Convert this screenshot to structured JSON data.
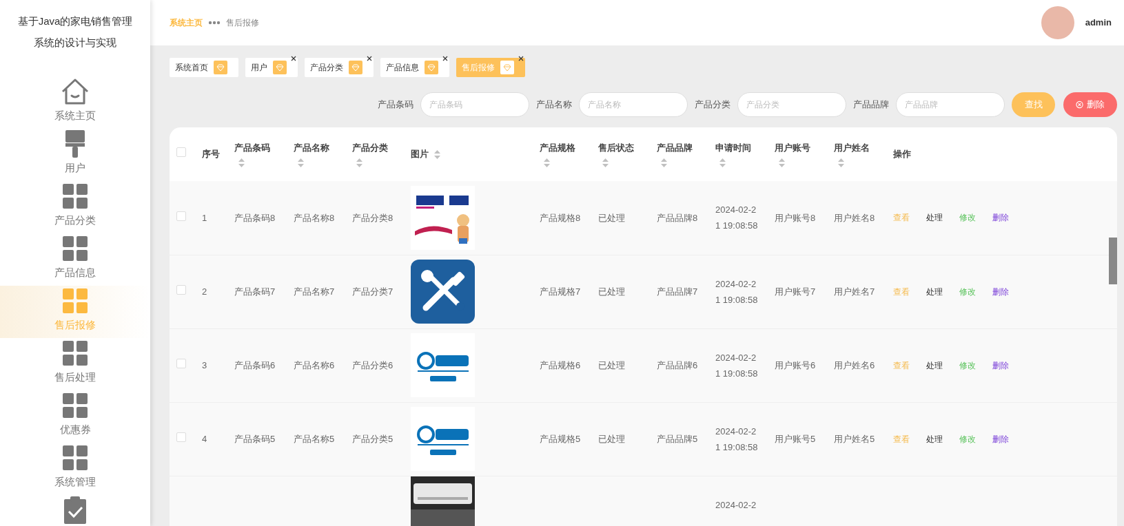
{
  "sidebar": {
    "title": "基于Java的家电销售管理系统的设计与实现",
    "items": [
      {
        "kind": "house",
        "label": "系统主页",
        "selected": false
      },
      {
        "kind": "brush",
        "label": "用户",
        "selected": false
      },
      {
        "kind": "grid",
        "label": "产品分类",
        "selected": false
      },
      {
        "kind": "grid",
        "label": "产品信息",
        "selected": false
      },
      {
        "kind": "grid",
        "label": "售后报修",
        "selected": true
      },
      {
        "kind": "grid",
        "label": "售后处理",
        "selected": false
      },
      {
        "kind": "grid",
        "label": "优惠券",
        "selected": false
      },
      {
        "kind": "grid",
        "label": "系统管理",
        "selected": false
      },
      {
        "kind": "clipboard",
        "selected": false
      }
    ]
  },
  "breadcrumb": [
    {
      "label": "系统主页",
      "current": false
    },
    {
      "label": "售后报修",
      "current": true
    }
  ],
  "user": {
    "name": "admin"
  },
  "tabs": [
    {
      "label": "系统首页",
      "closable": false,
      "selected": false
    },
    {
      "label": "用户",
      "closable": true,
      "selected": false
    },
    {
      "label": "产品分类",
      "closable": true,
      "selected": false
    },
    {
      "label": "产品信息",
      "closable": true,
      "selected": false
    },
    {
      "label": "售后报修",
      "closable": true,
      "selected": true
    }
  ],
  "search": {
    "fields": [
      {
        "label": "产品条码",
        "placeholder": "产品条码"
      },
      {
        "label": "产品名称",
        "placeholder": "产品名称"
      },
      {
        "label": "产品分类",
        "placeholder": "产品分类"
      },
      {
        "label": "产品品牌",
        "placeholder": "产品品牌"
      }
    ],
    "buttons": [
      {
        "kind": "search",
        "label": "查找"
      },
      {
        "kind": "delete",
        "label": "删除"
      }
    ]
  },
  "table": {
    "all_checked": false,
    "columns": [
      {
        "label": "序号",
        "sortable": false
      },
      {
        "label": "产品条码",
        "sortable": true
      },
      {
        "label": "产品名称",
        "sortable": true
      },
      {
        "label": "产品分类",
        "sortable": true
      },
      {
        "label": "图片",
        "sortable": true,
        "kind": "inline"
      },
      {
        "label": "产品规格",
        "sortable": true
      },
      {
        "label": "售后状态",
        "sortable": true
      },
      {
        "label": "产品品牌",
        "sortable": true
      },
      {
        "label": "申请时间",
        "sortable": true
      },
      {
        "label": "用户账号",
        "sortable": true
      },
      {
        "label": "用户姓名",
        "sortable": true
      },
      {
        "label": "操作",
        "sortable": false
      }
    ],
    "rows": [
      {
        "checked": false,
        "cells": [
          "1",
          "产品条码8",
          "产品名称8",
          "产品分类8",
          null,
          "产品规格8",
          "已处理",
          "产品品牌8",
          "2024-02-21 19:08:58",
          "用户账号8",
          "用户姓名8"
        ],
        "actions": [
          {
            "kind": "view",
            "label": "查看"
          },
          {
            "kind": "process",
            "label": "处理"
          },
          {
            "kind": "edit",
            "label": "修改"
          },
          {
            "kind": "delete",
            "label": "删除"
          }
        ]
      },
      {
        "checked": false,
        "cells": [
          "2",
          "产品条码7",
          "产品名称7",
          "产品分类7",
          null,
          "产品规格7",
          "已处理",
          "产品品牌7",
          "2024-02-21 19:08:58",
          "用户账号7",
          "用户姓名7"
        ],
        "actions": [
          {
            "kind": "view",
            "label": "查看"
          },
          {
            "kind": "process",
            "label": "处理"
          },
          {
            "kind": "edit",
            "label": "修改"
          },
          {
            "kind": "delete",
            "label": "删除"
          }
        ]
      },
      {
        "checked": false,
        "cells": [
          "3",
          "产品条码6",
          "产品名称6",
          "产品分类6",
          null,
          "产品规格6",
          "已处理",
          "产品品牌6",
          "2024-02-21 19:08:58",
          "用户账号6",
          "用户姓名6"
        ],
        "actions": [
          {
            "kind": "view",
            "label": "查看"
          },
          {
            "kind": "process",
            "label": "处理"
          },
          {
            "kind": "edit",
            "label": "修改"
          },
          {
            "kind": "delete",
            "label": "删除"
          }
        ]
      },
      {
        "checked": false,
        "cells": [
          "4",
          "产品条码5",
          "产品名称5",
          "产品分类5",
          null,
          "产品规格5",
          "已处理",
          "产品品牌5",
          "2024-02-21 19:08:58",
          "用户账号5",
          "用户姓名5"
        ],
        "actions": [
          {
            "kind": "view",
            "label": "查看"
          },
          {
            "kind": "process",
            "label": "处理"
          },
          {
            "kind": "edit",
            "label": "修改"
          },
          {
            "kind": "delete",
            "label": "删除"
          }
        ]
      },
      {
        "partial": true,
        "cells": [
          null,
          null,
          null,
          null,
          null,
          null,
          null,
          null,
          "2024-02-2",
          null,
          null
        ],
        "actions": []
      }
    ]
  }
}
